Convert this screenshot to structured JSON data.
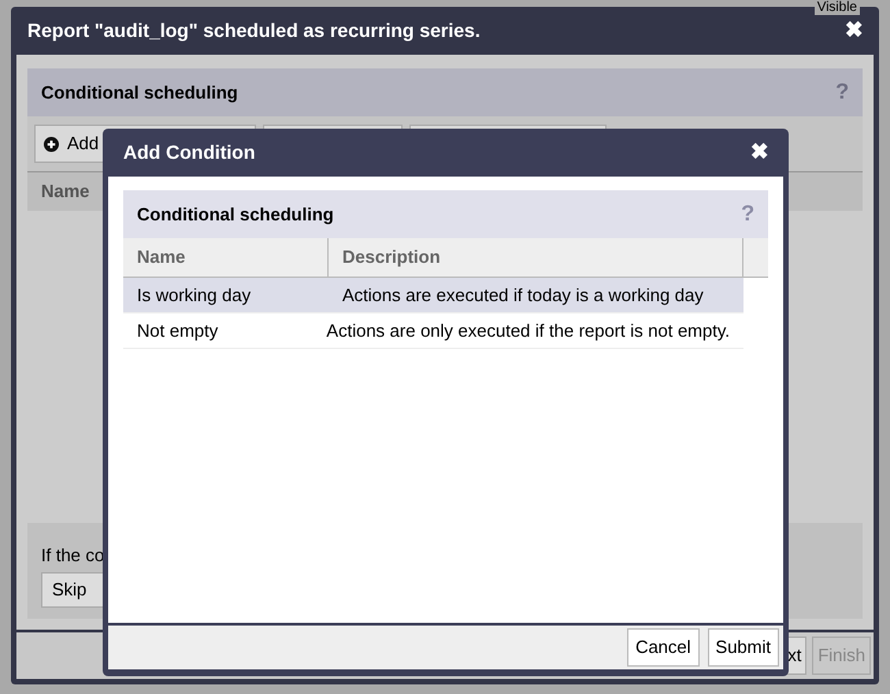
{
  "backdrop": {
    "label": "Visible"
  },
  "window": {
    "title": "Report \"audit_log\" scheduled as recurring series.",
    "close": "✖"
  },
  "panel": {
    "title": "Conditional scheduling",
    "help": "?",
    "toolbar": [
      {
        "label": "Add",
        "kind": "add"
      },
      {
        "kind": "plain"
      },
      {
        "kind": "plain"
      }
    ],
    "columns": [
      "Name"
    ]
  },
  "options": {
    "label": "If the co",
    "value": "Skip"
  },
  "footer": [
    {
      "label": "xt",
      "disabled": false
    },
    {
      "label": "Finish",
      "disabled": true
    }
  ],
  "dialog": {
    "title": "Add Condition",
    "close": "✖",
    "panel": {
      "title": "Conditional scheduling",
      "help": "?"
    },
    "columns": [
      "Name",
      "Description"
    ],
    "rows": [
      {
        "name": "Is working day",
        "description": "Actions are executed if today is a working day",
        "selected": true
      },
      {
        "name": "Not empty",
        "description": "Actions are only executed if the report is not empty.",
        "selected": false
      }
    ],
    "buttons": [
      "Cancel",
      "Submit"
    ]
  }
}
